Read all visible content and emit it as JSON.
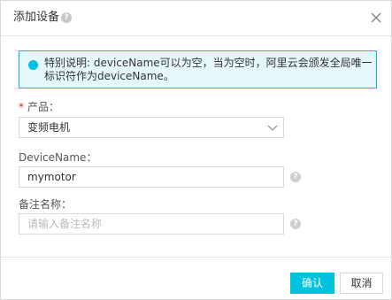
{
  "dialog": {
    "title": "添加设备",
    "help_glyph": "?"
  },
  "notice": {
    "text": "特别说明: deviceName可以为空，当为空时，阿里云会颁发全局唯一标识符作为deviceName。"
  },
  "form": {
    "product": {
      "required_mark": "*",
      "label": "产品：",
      "selected": "变频电机"
    },
    "device_name": {
      "label": "DeviceName：",
      "value": "mymotor",
      "help_glyph": "?"
    },
    "remark": {
      "label": "备注名称：",
      "placeholder": "请输入备注名称",
      "help_glyph": "?"
    }
  },
  "footer": {
    "confirm_label": "确认",
    "cancel_label": "取消"
  },
  "colors": {
    "accent": "#00c1de",
    "notice_bg": "#e6f7fb",
    "required": "#e1251b"
  }
}
